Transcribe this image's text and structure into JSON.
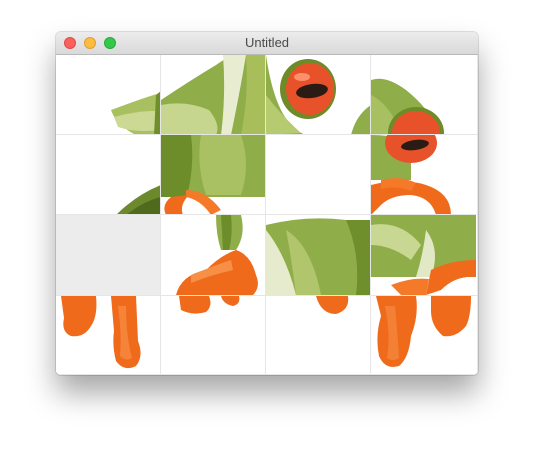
{
  "window": {
    "title": "Untitled"
  },
  "puzzle": {
    "rows": 4,
    "cols": 4,
    "empty_tile": {
      "row": 3,
      "col": 1
    },
    "tiles": [
      {
        "row": 1,
        "col": 1,
        "content": "frog-image-piece"
      },
      {
        "row": 1,
        "col": 2,
        "content": "frog-image-piece"
      },
      {
        "row": 1,
        "col": 3,
        "content": "frog-image-piece"
      },
      {
        "row": 1,
        "col": 4,
        "content": "frog-image-piece"
      },
      {
        "row": 2,
        "col": 1,
        "content": "frog-image-piece"
      },
      {
        "row": 2,
        "col": 2,
        "content": "frog-image-piece"
      },
      {
        "row": 2,
        "col": 3,
        "content": "frog-image-piece"
      },
      {
        "row": 2,
        "col": 4,
        "content": "frog-image-piece"
      },
      {
        "row": 3,
        "col": 1,
        "content": "empty"
      },
      {
        "row": 3,
        "col": 2,
        "content": "frog-image-piece"
      },
      {
        "row": 3,
        "col": 3,
        "content": "frog-image-piece"
      },
      {
        "row": 3,
        "col": 4,
        "content": "frog-image-piece"
      },
      {
        "row": 4,
        "col": 1,
        "content": "frog-image-piece"
      },
      {
        "row": 4,
        "col": 2,
        "content": "frog-image-piece"
      },
      {
        "row": 4,
        "col": 3,
        "content": "frog-image-piece"
      },
      {
        "row": 4,
        "col": 4,
        "content": "frog-image-piece"
      }
    ]
  },
  "colors": {
    "frog_green": "#8fae4a",
    "frog_dark_green": "#5e7d22",
    "frog_orange": "#f06a1c",
    "eye_red": "#e8522a",
    "empty_tile": "#ececec"
  }
}
